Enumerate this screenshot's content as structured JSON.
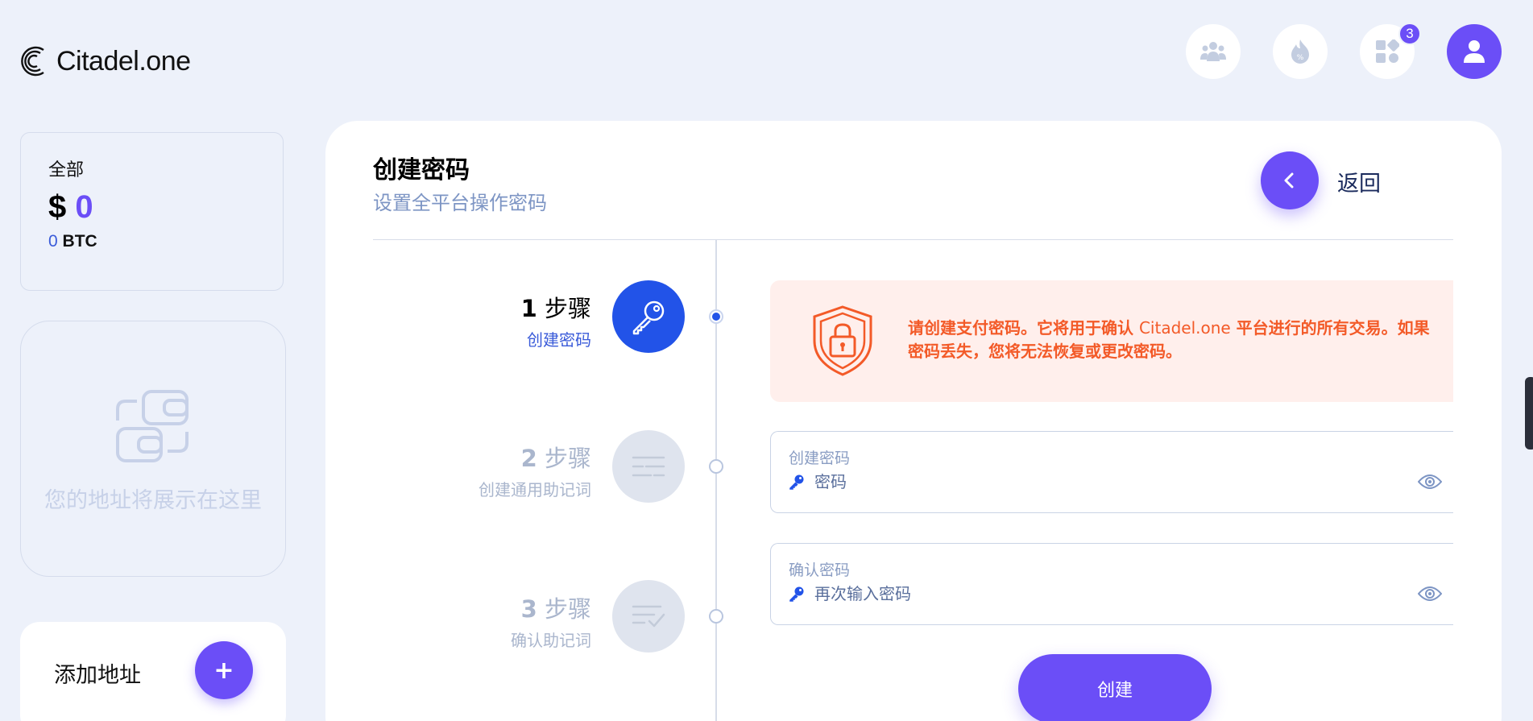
{
  "app": {
    "logo_text": "Citadel.one"
  },
  "header": {
    "apps_badge": "3"
  },
  "sidebar": {
    "total_label": "全部",
    "currency_symbol": "$",
    "total_value": "0",
    "btc_value": "0",
    "btc_unit": "BTC",
    "address_placeholder": "您的地址将展示在这里",
    "add_address_label": "添加地址",
    "add_button_symbol": "+"
  },
  "main": {
    "title": "创建密码",
    "subtitle": "设置全平台操作密码",
    "back_label": "返回",
    "steps": [
      {
        "number": "1",
        "word": "步骤",
        "label": "创建密码"
      },
      {
        "number": "2",
        "word": "步骤",
        "label": "创建通用助记词"
      },
      {
        "number": "3",
        "word": "步骤",
        "label": "确认助记词"
      }
    ],
    "alert_text_1": "请创建支付密码。它将用于确认 ",
    "alert_brand": "Citadel.one",
    "alert_text_2": " 平台进行的所有交易。如果密码丢失，您将无法恢复或更改密码。",
    "password_field": {
      "label": "创建密码",
      "placeholder": "密码"
    },
    "confirm_field": {
      "label": "确认密码",
      "placeholder": "再次输入密码"
    },
    "create_button": "创建"
  },
  "colors": {
    "accent": "#6b4ef7",
    "active_step": "#2253e8",
    "alert_bg": "#ffefec",
    "alert_text": "#f35a28",
    "background": "#edf1fa"
  }
}
